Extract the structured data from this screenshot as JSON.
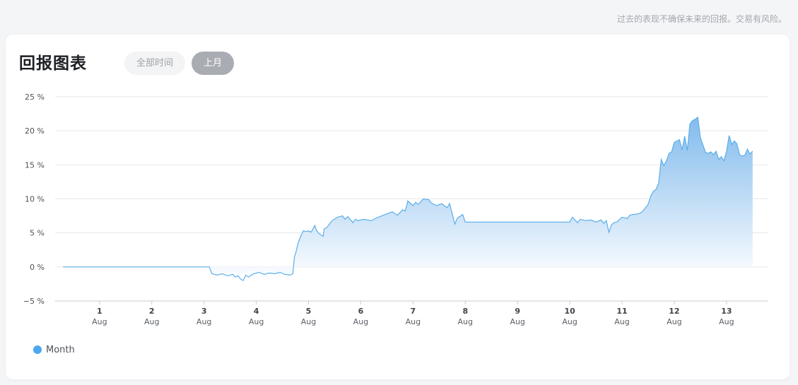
{
  "disclaimer": "过去的表现不确保未来的回报。交易有风险。",
  "card": {
    "title": "回报图表",
    "tabs": [
      {
        "label": "全部时间",
        "active": false
      },
      {
        "label": "上月",
        "active": true
      }
    ]
  },
  "colors": {
    "line": "#5aaeea",
    "fill_top": "#7db8ec",
    "fill_bottom": "#ffffff",
    "legend_dot": "#4aa8ee",
    "tab_active_bg": "#a9acb2"
  },
  "legend_placement": "bottom-left",
  "chart_data": {
    "type": "area",
    "grid": true,
    "ylim": [
      -5,
      25
    ],
    "xlim": [
      0.15,
      13.8
    ],
    "yticks": [
      -5,
      0,
      5,
      10,
      15,
      20,
      25
    ],
    "ytick_labels": [
      "−5 %",
      "0 %",
      "5 %",
      "10 %",
      "15 %",
      "20 %",
      "25 %"
    ],
    "xticks": [
      1,
      2,
      3,
      4,
      5,
      6,
      7,
      8,
      9,
      10,
      11,
      12,
      13
    ],
    "xtick_labels": [
      {
        "day": "1",
        "month": "Aug"
      },
      {
        "day": "2",
        "month": "Aug"
      },
      {
        "day": "3",
        "month": "Aug"
      },
      {
        "day": "4",
        "month": "Aug"
      },
      {
        "day": "5",
        "month": "Aug"
      },
      {
        "day": "6",
        "month": "Aug"
      },
      {
        "day": "7",
        "month": "Aug"
      },
      {
        "day": "8",
        "month": "Aug"
      },
      {
        "day": "9",
        "month": "Aug"
      },
      {
        "day": "10",
        "month": "Aug"
      },
      {
        "day": "11",
        "month": "Aug"
      },
      {
        "day": "12",
        "month": "Aug"
      },
      {
        "day": "13",
        "month": "Aug"
      }
    ],
    "series": [
      {
        "name": "Month",
        "x": [
          0.3,
          1.0,
          2.0,
          3.0,
          3.1,
          3.15,
          3.25,
          3.35,
          3.45,
          3.55,
          3.6,
          3.65,
          3.7,
          3.75,
          3.8,
          3.85,
          3.95,
          4.05,
          4.15,
          4.25,
          4.35,
          4.45,
          4.55,
          4.65,
          4.7,
          4.73,
          4.76,
          4.8,
          4.85,
          4.9,
          4.95,
          5.0,
          5.05,
          5.12,
          5.15,
          5.2,
          5.28,
          5.3,
          5.35,
          5.45,
          5.55,
          5.65,
          5.7,
          5.75,
          5.85,
          5.9,
          5.95,
          6.05,
          6.2,
          6.3,
          6.4,
          6.5,
          6.6,
          6.7,
          6.75,
          6.8,
          6.85,
          6.9,
          7.0,
          7.05,
          7.1,
          7.2,
          7.3,
          7.35,
          7.45,
          7.55,
          7.65,
          7.7,
          7.75,
          7.8,
          7.85,
          7.95,
          8.0,
          8.5,
          9.0,
          9.5,
          10.0,
          10.05,
          10.1,
          10.15,
          10.2,
          10.3,
          10.4,
          10.5,
          10.6,
          10.65,
          10.7,
          10.75,
          10.8,
          10.85,
          10.9,
          11.0,
          11.1,
          11.15,
          11.2,
          11.3,
          11.35,
          11.4,
          11.5,
          11.55,
          11.6,
          11.65,
          11.7,
          11.75,
          11.8,
          11.85,
          11.9,
          11.95,
          12.0,
          12.05,
          12.1,
          12.15,
          12.2,
          12.25,
          12.3,
          12.35,
          12.4,
          12.45,
          12.5,
          12.55,
          12.6,
          12.65,
          12.7,
          12.75,
          12.8,
          12.85,
          12.9,
          12.95,
          13.0,
          13.05,
          13.1,
          13.15,
          13.2,
          13.25,
          13.3,
          13.35,
          13.4,
          13.45,
          13.5
        ],
        "values": [
          0,
          0,
          0,
          0,
          0,
          -1.0,
          -1.2,
          -1.0,
          -1.3,
          -1.1,
          -1.5,
          -1.3,
          -1.8,
          -2.0,
          -1.2,
          -1.5,
          -1.0,
          -0.8,
          -1.1,
          -0.9,
          -1.0,
          -0.8,
          -1.1,
          -1.2,
          -1.0,
          1.5,
          2.2,
          3.5,
          4.5,
          5.3,
          5.2,
          5.3,
          5.1,
          6.1,
          5.4,
          4.9,
          4.5,
          5.6,
          5.8,
          6.8,
          7.3,
          7.5,
          7.0,
          7.4,
          6.5,
          7.0,
          6.8,
          7.0,
          6.8,
          7.2,
          7.5,
          7.8,
          8.1,
          7.6,
          8.0,
          8.4,
          8.2,
          9.7,
          9.0,
          9.5,
          9.2,
          10.0,
          9.9,
          9.4,
          9.0,
          9.3,
          8.7,
          9.3,
          7.8,
          6.3,
          7.2,
          7.7,
          6.6,
          6.6,
          6.6,
          6.6,
          6.6,
          7.3,
          6.9,
          6.5,
          7.0,
          6.8,
          6.9,
          6.6,
          6.9,
          6.4,
          6.8,
          5.1,
          6.2,
          6.5,
          6.6,
          7.3,
          7.1,
          7.6,
          7.7,
          7.8,
          7.9,
          8.2,
          9.2,
          10.4,
          11.1,
          11.4,
          12.3,
          15.8,
          14.9,
          15.6,
          16.7,
          16.9,
          18.3,
          18.5,
          18.7,
          17.2,
          19.2,
          17.1,
          21.0,
          21.5,
          21.7,
          22.0,
          19.0,
          17.9,
          16.8,
          16.7,
          16.9,
          16.5,
          17.0,
          15.8,
          16.2,
          15.6,
          17.0,
          19.3,
          18.0,
          18.5,
          18.1,
          16.5,
          16.3,
          16.4,
          17.3,
          16.6,
          17.0
        ]
      }
    ]
  }
}
